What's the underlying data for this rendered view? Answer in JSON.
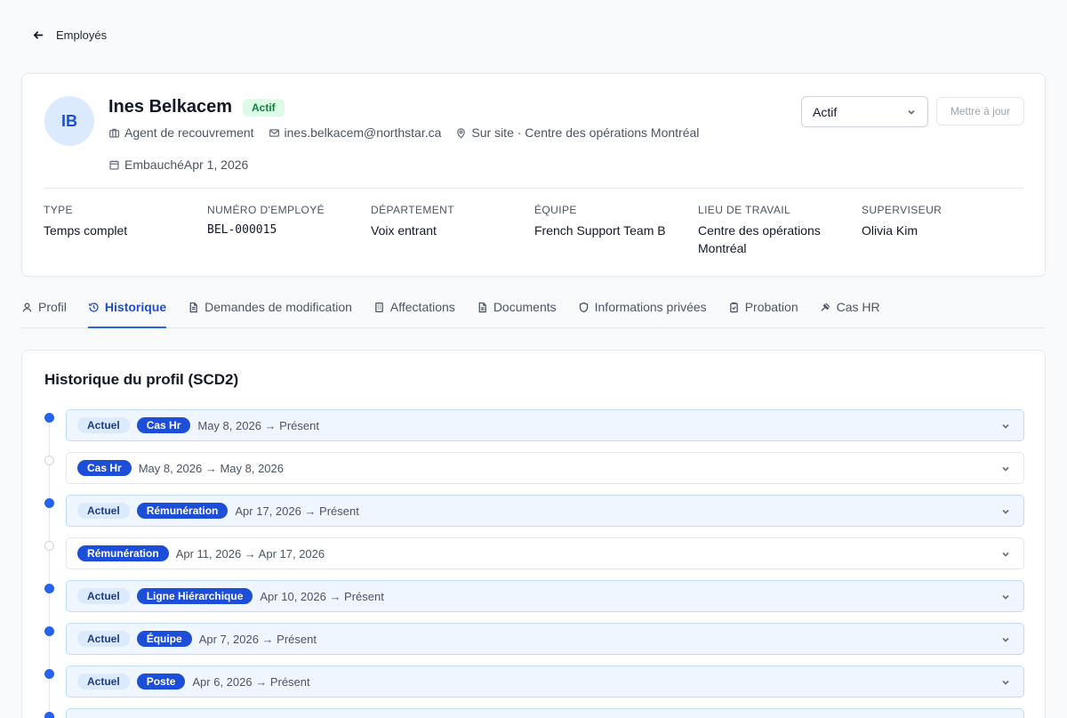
{
  "nav": {
    "back_label": "Employés"
  },
  "employee": {
    "initials": "IB",
    "name": "Ines Belkacem",
    "status_badge": "Actif",
    "role": "Agent de recouvrement",
    "email": "ines.belkacem@northstar.ca",
    "location": "Sur site · Centre des opérations Montréal",
    "hired": "EmbauchéApr 1, 2026"
  },
  "actions": {
    "status_value": "Actif",
    "update_label": "Mettre à jour"
  },
  "fields": [
    {
      "label": "Type",
      "value": "Temps complet"
    },
    {
      "label": "Numéro d'employé",
      "value": "BEL-000015"
    },
    {
      "label": "Département",
      "value": "Voix entrant"
    },
    {
      "label": "Équipe",
      "value": "French Support Team B"
    },
    {
      "label": "Lieu de travail",
      "value": "Centre des opérations Montréal"
    },
    {
      "label": "Superviseur",
      "value": "Olivia Kim"
    }
  ],
  "tabs": [
    {
      "label": "Profil",
      "icon": "user-icon"
    },
    {
      "label": "Historique",
      "icon": "history-icon"
    },
    {
      "label": "Demandes de modification",
      "icon": "file-icon"
    },
    {
      "label": "Affectations",
      "icon": "building-icon"
    },
    {
      "label": "Documents",
      "icon": "document-icon"
    },
    {
      "label": "Informations privées",
      "icon": "shield-icon"
    },
    {
      "label": "Probation",
      "icon": "clipboard-icon"
    },
    {
      "label": "Cas HR",
      "icon": "gavel-icon"
    }
  ],
  "history": {
    "title": "Historique du profil (SCD2)",
    "current_label": "Actuel",
    "entries": [
      {
        "current": true,
        "type": "Cas Hr",
        "range": "May 8, 2026 → Présent"
      },
      {
        "current": false,
        "type": "Cas Hr",
        "range": "May 8, 2026 → May 8, 2026"
      },
      {
        "current": true,
        "type": "Rémunération",
        "range": "Apr 17, 2026 → Présent"
      },
      {
        "current": false,
        "type": "Rémunération",
        "range": "Apr 11, 2026 → Apr 17, 2026"
      },
      {
        "current": true,
        "type": "Ligne Hiérarchique",
        "range": "Apr 10, 2026 → Présent"
      },
      {
        "current": true,
        "type": "Équipe",
        "range": "Apr 7, 2026 → Présent"
      },
      {
        "current": true,
        "type": "Poste",
        "range": "Apr 6, 2026 → Présent"
      }
    ]
  }
}
